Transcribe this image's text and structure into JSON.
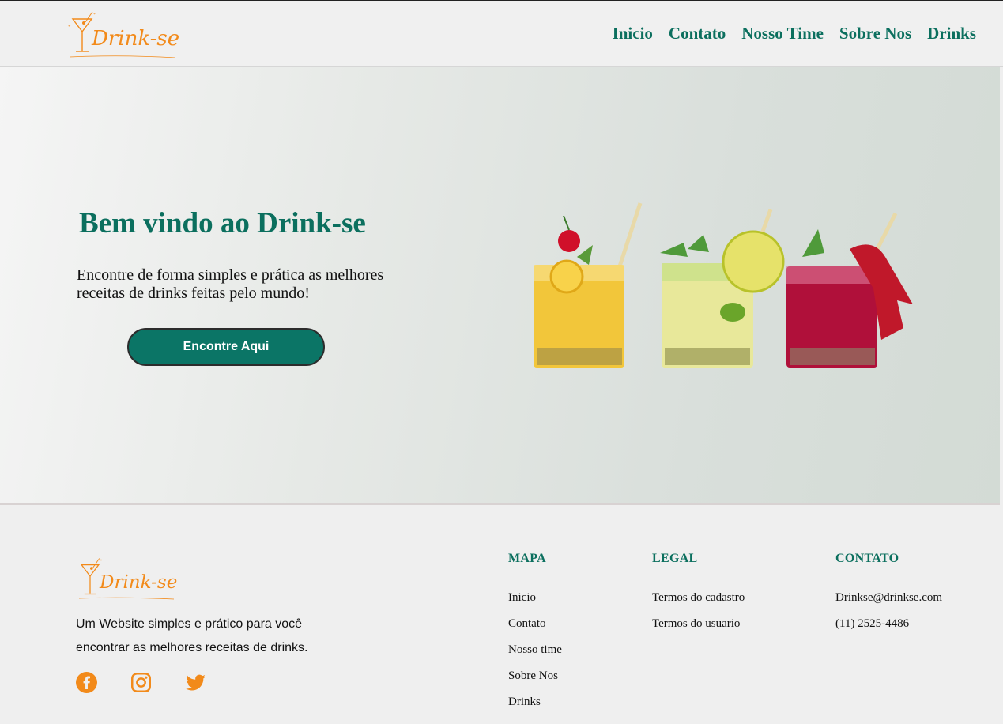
{
  "brand": {
    "name": "Drink-se",
    "accent": "#f28a1a",
    "primary": "#0b6f5e"
  },
  "nav": {
    "items": [
      "Inicio",
      "Contato",
      "Nosso Time",
      "Sobre Nos",
      "Drinks"
    ]
  },
  "hero": {
    "title": "Bem vindo ao Drink-se",
    "text": "Encontre de forma simples e prática as melhores receitas de drinks feitas pelo mundo!",
    "button_label": "Encontre Aqui"
  },
  "footer": {
    "description": "Um Website simples e prático para você encontrar as melhores receitas de drinks.",
    "socials": [
      "facebook-icon",
      "instagram-icon",
      "twitter-icon"
    ],
    "columns": [
      {
        "title": "MAPA",
        "items": [
          "Inicio",
          "Contato",
          "Nosso time",
          "Sobre Nos",
          "Drinks"
        ]
      },
      {
        "title": "LEGAL",
        "items": [
          "Termos do cadastro",
          "Termos do usuario"
        ]
      },
      {
        "title": "CONTATO",
        "items": [
          "Drinkse@drinkse.com",
          "(11) 2525-4486"
        ]
      }
    ]
  }
}
